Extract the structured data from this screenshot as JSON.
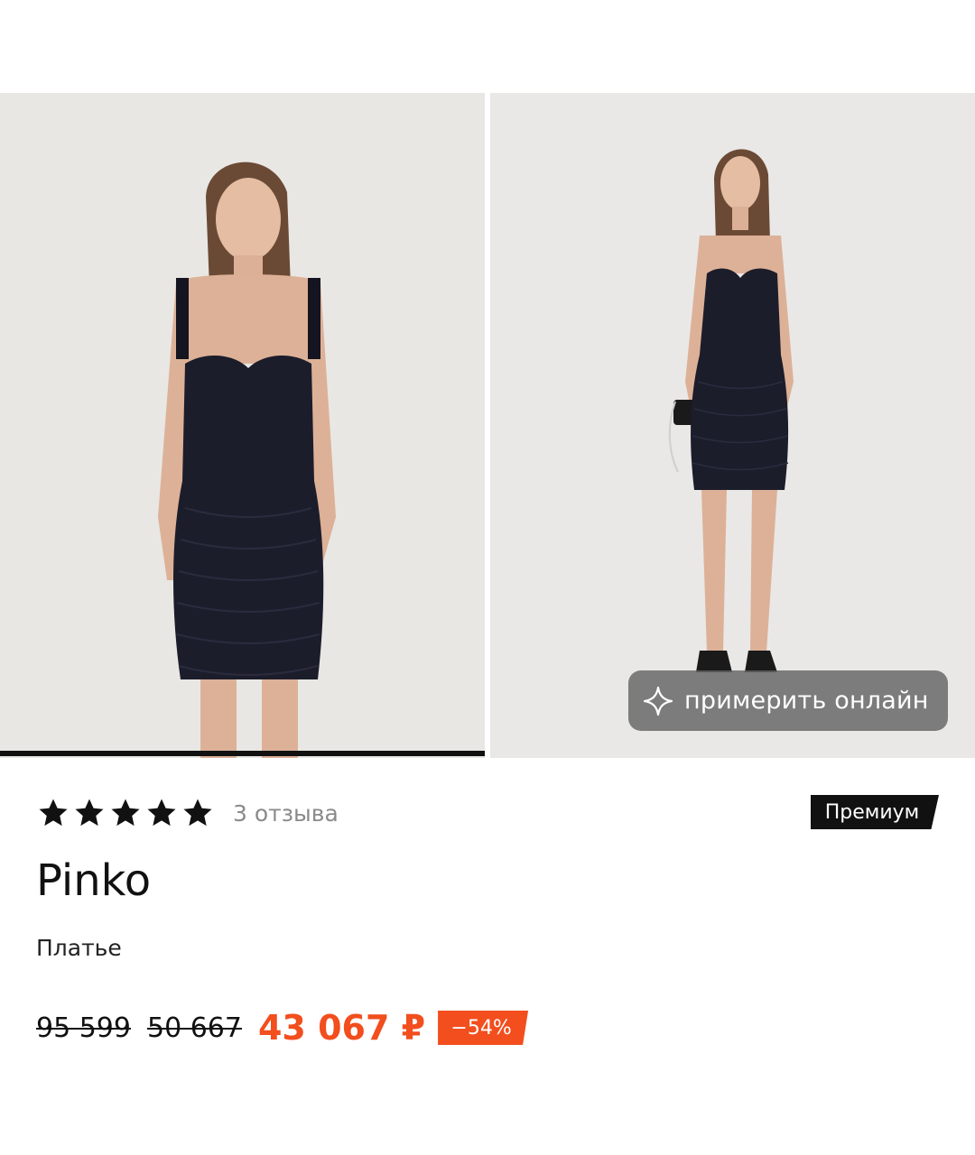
{
  "gallery": {
    "images": [
      {
        "alt": "model-front-view"
      },
      {
        "alt": "model-full-length"
      }
    ],
    "active_index": 0,
    "try_on_label": "примерить онлайн"
  },
  "product": {
    "rating": 5,
    "rating_max": 5,
    "reviews_label": "3 отзыва",
    "badge": "Премиум",
    "brand": "Pinko",
    "type": "Платье",
    "prices": {
      "old_1": "95 599",
      "old_2": "50 667",
      "current": "43 067 ₽",
      "discount": "−54%"
    }
  },
  "colors": {
    "accent": "#f24e1e",
    "badge_bg": "#111111",
    "photo_bg": "#e9e8e6",
    "dress": "#1c1d2b"
  },
  "icons": {
    "star": "star-icon",
    "sparkle": "sparkle-icon"
  }
}
